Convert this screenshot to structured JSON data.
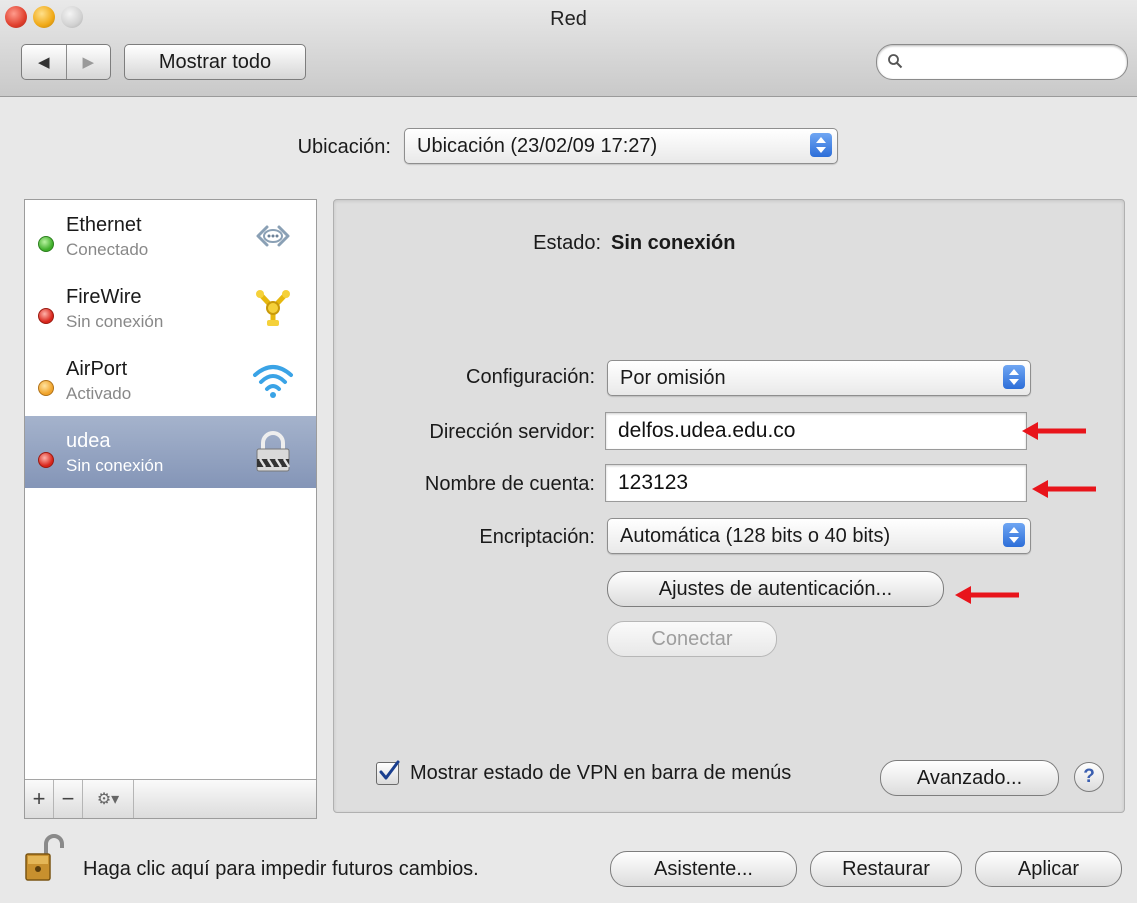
{
  "window": {
    "title": "Red"
  },
  "toolbar": {
    "back_glyph": "◀",
    "forward_glyph": "▶",
    "show_all_label": "Mostrar todo",
    "search_placeholder": ""
  },
  "location": {
    "label": "Ubicación:",
    "value": "Ubicación (23/02/09 17:27)"
  },
  "services": [
    {
      "name": "Ethernet",
      "status": "Conectado",
      "status_color": "green",
      "icon": "ethernet-icon",
      "selected": false
    },
    {
      "name": "FireWire",
      "status": "Sin conexión",
      "status_color": "red",
      "icon": "firewire-icon",
      "selected": false
    },
    {
      "name": "AirPort",
      "status": "Activado",
      "status_color": "amber",
      "icon": "wifi-icon",
      "selected": false
    },
    {
      "name": "udea",
      "status": "Sin conexión",
      "status_color": "red",
      "icon": "vpn-lock-icon",
      "selected": true
    }
  ],
  "sidebar_buttons": {
    "add": "+",
    "remove": "−",
    "gear": "⚙▾"
  },
  "detail": {
    "status_label": "Estado:",
    "status_value": "Sin conexión",
    "configuration": {
      "label": "Configuración:",
      "value": "Por omisión"
    },
    "server_address": {
      "label": "Dirección servidor:",
      "value": "delfos.udea.edu.co"
    },
    "account_name": {
      "label": "Nombre de cuenta:",
      "value": "123123"
    },
    "encryption": {
      "label": "Encriptación:",
      "value": "Automática (128 bits o 40 bits)"
    },
    "auth_settings_button": "Ajustes de autenticación...",
    "connect_button": "Conectar"
  },
  "vpn_menu": {
    "checked": true,
    "label": "Mostrar estado de VPN en barra de menús"
  },
  "advanced_button": "Avanzado...",
  "help_button": "?",
  "lock_text": "Haga clic aquí para impedir futuros cambios.",
  "footer_buttons": {
    "assistant": "Asistente...",
    "revert": "Restaurar",
    "apply": "Aplicar"
  },
  "colors": {
    "annotation_arrow": "#e8141b",
    "selection": "#8c9cbd",
    "popup_arrows": "#3b7be6",
    "connected": "#3fae2a",
    "disconnected": "#d8241a",
    "active": "#f0a32a"
  }
}
